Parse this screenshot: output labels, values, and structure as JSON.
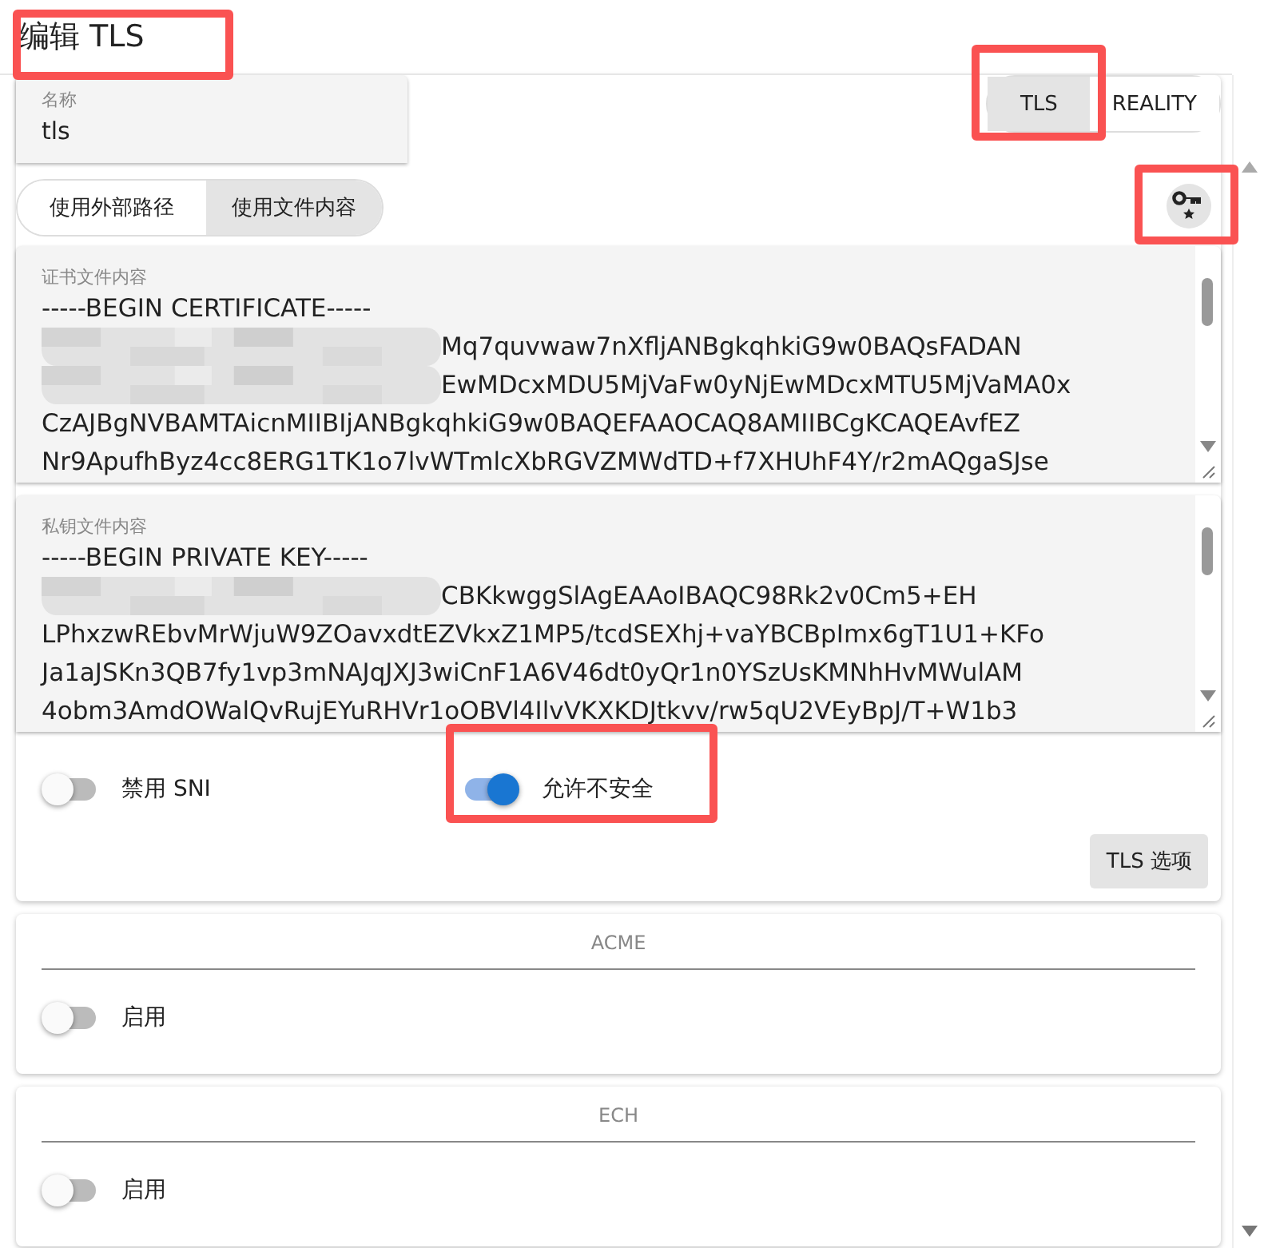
{
  "title": {
    "text": "编辑 TLS",
    "highlighted": true
  },
  "name_field": {
    "label": "名称",
    "value": "tls"
  },
  "mode_tabs": [
    {
      "label": "TLS",
      "selected": true,
      "highlighted": true
    },
    {
      "label": "REALITY",
      "selected": false,
      "highlighted": false
    }
  ],
  "source_tabs": [
    {
      "label": "使用外部路径",
      "selected": false
    },
    {
      "label": "使用文件内容",
      "selected": true
    }
  ],
  "key_button": {
    "highlighted": true
  },
  "text_fields": [
    {
      "label": "证书文件内容",
      "lines": [
        {
          "text": "-----BEGIN CERTIFICATE-----",
          "redacted": false
        },
        {
          "text": "Mq7quvwaw7nXfljANBgkqhkiG9w0BAQsFADAN",
          "redacted": true
        },
        {
          "text": "EwMDcxMDU5MjVaFw0yNjEwMDcxMTU5MjVaMA0x",
          "redacted": true
        },
        {
          "text": "CzAJBgNVBAMTAicnMIIBIjANBgkqhkiG9w0BAQEFAAOCAQ8AMIIBCgKCAQEAvfEZ",
          "redacted": false
        },
        {
          "text": "Nr9ApufhByz4cc8ERG1TK1o7lvWTmlcXbRGVZMWdTD+f7XHUhF4Y/r2mAQgaSJse",
          "redacted": false
        }
      ]
    },
    {
      "label": "私钥文件内容",
      "lines": [
        {
          "text": "-----BEGIN PRIVATE KEY-----",
          "redacted": false
        },
        {
          "text": "CBKkwggSlAgEAAoIBAQC98Rk2v0Cm5+EH",
          "redacted": true
        },
        {
          "text": "LPhxzwREbvMrWjuW9ZOavxdtEZVkxZ1MP5/tcdSEXhj+vaYBCBpImx6gT1U1+KFo",
          "redacted": false
        },
        {
          "text": "Ja1aJSKn3QB7fy1vp3mNAJqJXJ3wiCnF1A6V46dt0yQr1n0YSzUsKMNhHvMWulAM",
          "redacted": false
        },
        {
          "text": "4obm3AmdOWalQvRujEYuRHVr1oOBVl4IlvVKXKDJtkvv/rw5qU2VEyBpJ/T+W1b3",
          "redacted": false
        }
      ]
    }
  ],
  "switches": [
    {
      "label": "禁用 SNI",
      "on": false,
      "highlighted": false
    },
    {
      "label": "允许不安全",
      "on": true,
      "highlighted": true
    }
  ],
  "options_button": "TLS 选项",
  "sections": [
    {
      "title": "ACME",
      "switch": {
        "label": "启用",
        "on": false
      }
    },
    {
      "title": "ECH",
      "switch": {
        "label": "启用",
        "on": false
      }
    }
  ]
}
